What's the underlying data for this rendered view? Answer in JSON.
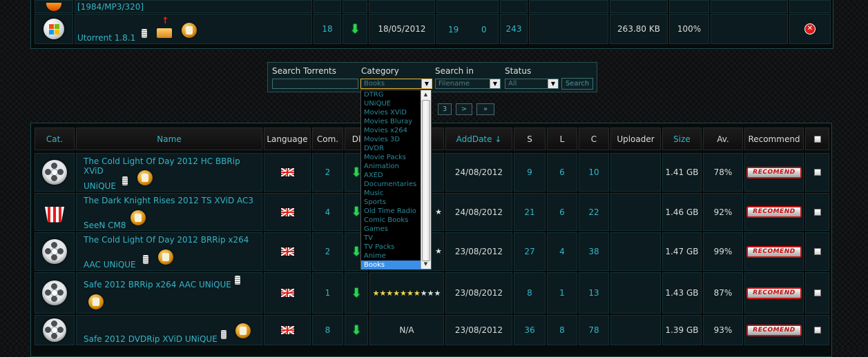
{
  "top_rows": [
    {
      "name_partial": "[1984/MP3/320]"
    },
    {
      "name": "Utorrent 1.8.1",
      "comments": "18",
      "date": "18/05/2012",
      "seeders": "19",
      "leechers": "0",
      "completed": "243",
      "size": "263.80 KB",
      "available": "100%"
    }
  ],
  "search": {
    "label_search": "Search Torrents",
    "label_category": "Category",
    "label_search_in": "Search in",
    "label_status": "Status",
    "category_value": "Books",
    "search_in_value": "Filename",
    "status_value": "All",
    "button": "Search"
  },
  "pager": {
    "page3": "3",
    "next": ">",
    "last": "»"
  },
  "category_options": [
    "DTRG",
    "UNiQUE",
    "Movies XViD",
    "Movies Bluray",
    "Movies x264",
    "Movies 3D",
    "DVDR",
    "Movie Packs",
    "Animation",
    "AXED",
    "Documentaries",
    "Music",
    "Sports",
    "Old Time Radio",
    "Comic Books",
    "Games",
    "TV",
    "TV Packs",
    "Anime",
    "Books"
  ],
  "columns": {
    "cat": "Cat.",
    "name": "Name",
    "language": "Language",
    "com": "Com.",
    "dl": "Dl",
    "adddate": "AddDate ↓",
    "s": "S",
    "l": "L",
    "c": "C",
    "uploader": "Uploader",
    "size": "Size",
    "av": "Av.",
    "recommend": "Recommend"
  },
  "rows": [
    {
      "line1": "The Cold Light Of Day 2012 HC BBRip XViD",
      "line2": "UNiQUE",
      "com": "2",
      "rating": "",
      "date": "24/08/2012",
      "s": "9",
      "l": "6",
      "c": "10",
      "size": "1.41 GB",
      "av": "78%",
      "rec": "RECOMEND"
    },
    {
      "line1": "The Dark Knight Rises 2012 TS XViD AC3",
      "line2": "SeeN CM8",
      "com": "4",
      "rating": "",
      "date": "24/08/2012",
      "s": "21",
      "l": "6",
      "c": "22",
      "size": "1.46 GB",
      "av": "92%",
      "rec": "RECOMEND"
    },
    {
      "line1": "The Cold Light Of Day 2012 BRRip x264",
      "line2": "AAC UNiQUE",
      "com": "2",
      "rating": "",
      "date": "23/08/2012",
      "s": "27",
      "l": "4",
      "c": "38",
      "size": "1.47 GB",
      "av": "99%",
      "rec": "RECOMEND"
    },
    {
      "line1": "Safe 2012 BRRip x264 AAC UNiQUE",
      "line2": "",
      "com": "1",
      "rating": "",
      "date": "23/08/2012",
      "s": "8",
      "l": "1",
      "c": "13",
      "size": "1.43 GB",
      "av": "87%",
      "rec": "RECOMEND"
    },
    {
      "line1": "",
      "line2": "Safe 2012 DVDRip XViD UNiQUE",
      "com": "8",
      "rating": "N/A",
      "date": "23/08/2012",
      "s": "36",
      "l": "8",
      "c": "78",
      "size": "1.39 GB",
      "av": "93%",
      "rec": "RECOMEND"
    }
  ]
}
